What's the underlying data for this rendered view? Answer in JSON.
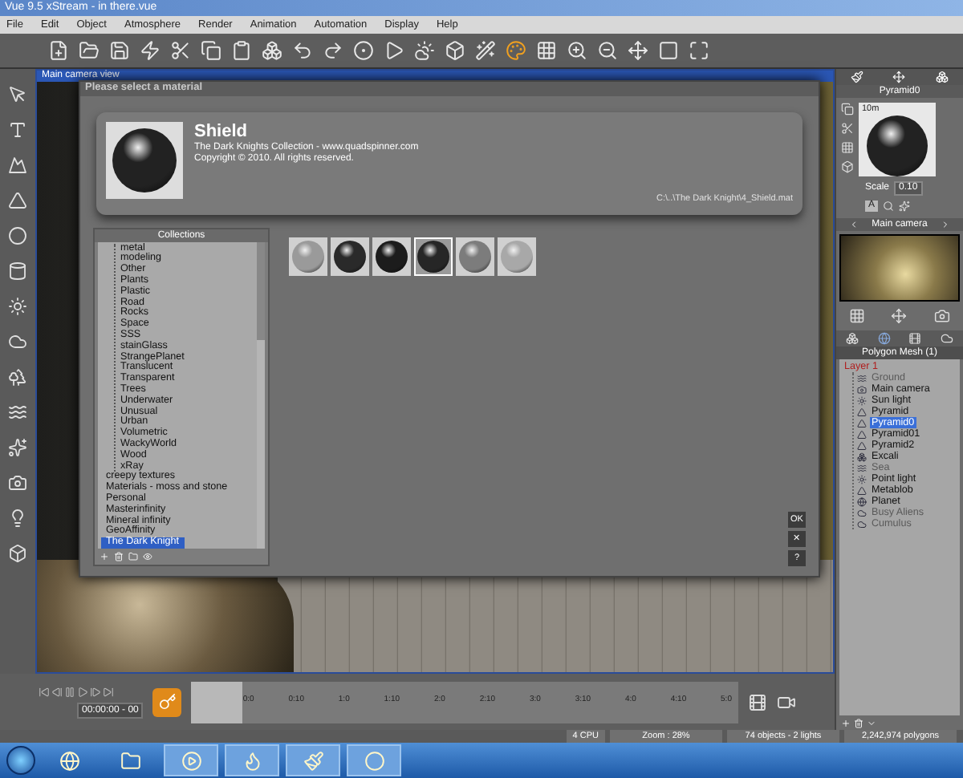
{
  "window": {
    "title": "Vue 9.5 xStream - in there.vue"
  },
  "menu": [
    "File",
    "Edit",
    "Object",
    "Atmosphere",
    "Render",
    "Animation",
    "Automation",
    "Display",
    "Help"
  ],
  "viewport": {
    "title": "Main camera view"
  },
  "dialog": {
    "title": "Please select a material",
    "material": {
      "name": "Shield",
      "collection": "The Dark Knights Collection - www.quadspinner.com",
      "copyright": "Copyright © 2010. All rights reserved.",
      "path": "C:\\..\\The Dark Knight\\4_Shield.mat"
    },
    "collections": {
      "title": "Collections",
      "items": [
        {
          "children": [
            {
              "label": "metal",
              "selected": false
            },
            {
              "label": "modeling",
              "selected": false
            },
            {
              "label": "Other",
              "selected": false
            },
            {
              "label": "Plants",
              "selected": false
            },
            {
              "label": "Plastic",
              "selected": false
            },
            {
              "label": "Road",
              "selected": false
            },
            {
              "label": "Rocks",
              "selected": false
            },
            {
              "label": "Space",
              "selected": false
            },
            {
              "label": "SSS",
              "selected": false
            },
            {
              "label": "stainGlass",
              "selected": false
            },
            {
              "label": "StrangePlanet",
              "selected": false
            },
            {
              "label": "Translucent",
              "selected": false
            },
            {
              "label": "Transparent",
              "selected": false
            },
            {
              "label": "Trees",
              "selected": false
            },
            {
              "label": "Underwater",
              "selected": false
            },
            {
              "label": "Unusual",
              "selected": false
            },
            {
              "label": "Urban",
              "selected": false
            },
            {
              "label": "Volumetric",
              "selected": false
            },
            {
              "label": "WackyWorld",
              "selected": false
            },
            {
              "label": "Wood",
              "selected": false
            },
            {
              "label": "xRay",
              "selected": false
            }
          ]
        },
        {
          "label": "creepy textures",
          "selected": false
        },
        {
          "label": "Materials - moss and stone",
          "selected": false
        },
        {
          "label": "Personal",
          "selected": false
        },
        {
          "label": "Masterinfinity",
          "selected": false
        },
        {
          "label": "Mineral infinity",
          "selected": false
        },
        {
          "label": "GeoAffinity",
          "selected": false
        },
        {
          "label": "The Dark Knight",
          "selected": true
        }
      ]
    },
    "materials": [
      {
        "color": "#9a9a9a",
        "selected": false
      },
      {
        "color": "#2a2a2a",
        "selected": false
      },
      {
        "color": "#1c1c1c",
        "selected": false
      },
      {
        "color": "#262626",
        "selected": true
      },
      {
        "color": "#7c7c7c",
        "selected": false
      },
      {
        "color": "#a8a8a8",
        "selected": false
      }
    ],
    "side_buttons": [
      "OK",
      "✕",
      "?"
    ]
  },
  "right_panel": {
    "object_name": "Pyramid0",
    "distance": "10m",
    "scale_label": "Scale",
    "scale_value": "0.10",
    "channel": "A",
    "camera": "Main camera",
    "mesh_header": "Polygon Mesh (1)",
    "layers": [
      {
        "label": "Layer 1",
        "selected": false,
        "children": [
          {
            "label": "Ground",
            "kind": "ground",
            "disabled": true,
            "selected": false
          },
          {
            "label": "Main camera",
            "kind": "camera",
            "disabled": false,
            "selected": false
          },
          {
            "label": "Sun light",
            "kind": "light",
            "disabled": false,
            "selected": false
          },
          {
            "label": "Pyramid",
            "kind": "mesh",
            "disabled": false,
            "selected": false
          },
          {
            "label": "Pyramid0",
            "kind": "mesh",
            "disabled": false,
            "selected": true
          },
          {
            "label": "Pyramid01",
            "kind": "mesh",
            "disabled": false,
            "selected": false
          },
          {
            "label": "Pyramid2",
            "kind": "mesh",
            "disabled": false,
            "selected": false
          },
          {
            "label": "Excali",
            "kind": "group",
            "disabled": false,
            "selected": false
          },
          {
            "label": "Sea",
            "kind": "ground",
            "disabled": true,
            "selected": false
          },
          {
            "label": "Point light",
            "kind": "light",
            "disabled": false,
            "selected": false
          },
          {
            "label": "Metablob",
            "kind": "mesh",
            "disabled": false,
            "selected": false
          },
          {
            "label": "Planet",
            "kind": "planet",
            "disabled": false,
            "selected": false
          },
          {
            "label": "Busy Aliens",
            "kind": "cloud",
            "disabled": true,
            "selected": false
          },
          {
            "label": "Cumulus",
            "kind": "cloud",
            "disabled": true,
            "selected": false
          }
        ]
      }
    ]
  },
  "timeline": {
    "time": "00:00:00 - 00",
    "ticks": [
      "0:0",
      "0:10",
      "1:0",
      "1:10",
      "2:0",
      "2:10",
      "3:0",
      "3:10",
      "4:0",
      "4:10",
      "5:0"
    ]
  },
  "status_bar": [
    "4 CPU",
    "Zoom : 28%",
    "74 objects - 2 lights",
    "2,242,974 polygons"
  ]
}
